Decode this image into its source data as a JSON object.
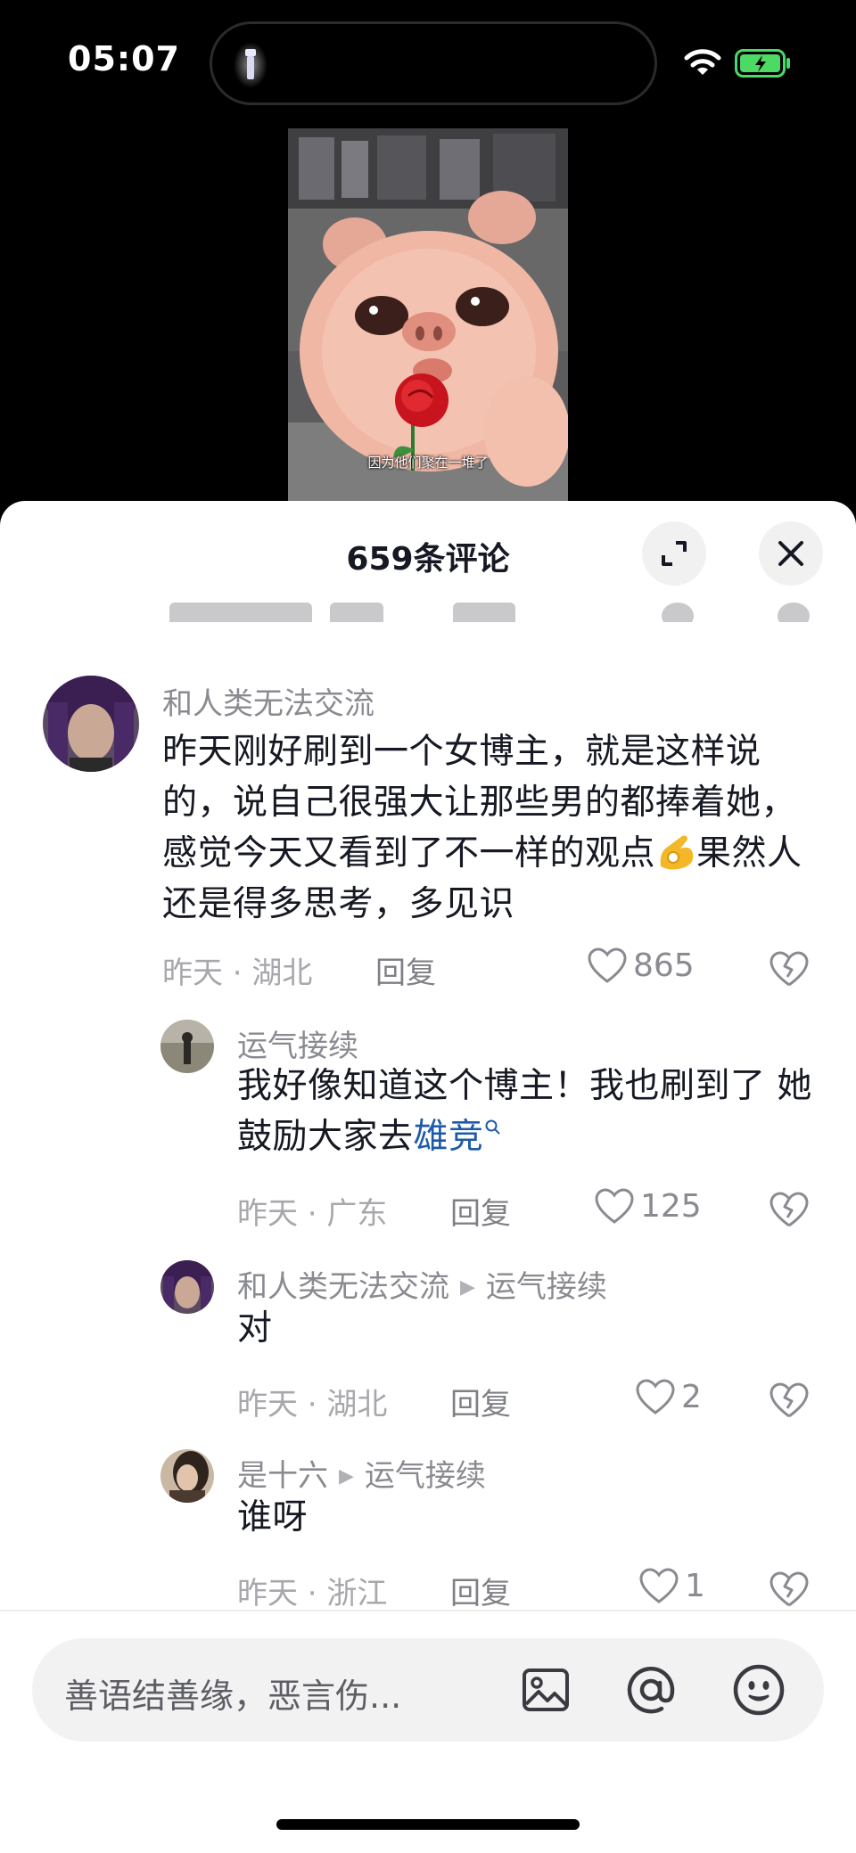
{
  "status_bar": {
    "time": "05:07"
  },
  "video": {
    "subtitle": "因为他们聚在一堆了"
  },
  "sheet": {
    "title": "659条评论",
    "close_symbol": "✕"
  },
  "comments": [
    {
      "username": "和人类无法交流",
      "text_1": "昨天刚好刷到一个女博主，就是这样说的，说自己很强大让那些男的都捧着她，感觉今天又看到了不一样的观点",
      "text_2": "果然人还是得多思考，多见识",
      "emoji": "ok-hand-emoji",
      "meta": "昨天 · 湖北",
      "reply": "回复",
      "likes": "865"
    },
    {
      "username": "运气接续",
      "text_1": "我好像知道这个博主！我也刷到了 她鼓励大家去",
      "link": "雄竞",
      "meta": "昨天 · 广东",
      "reply": "回复",
      "likes": "125"
    },
    {
      "username": "和人类无法交流",
      "reply_to": "运气接续",
      "text_1": "对",
      "meta": "昨天 · 湖北",
      "reply": "回复",
      "likes": "2"
    },
    {
      "username": "是十六",
      "reply_to": "运气接续",
      "text_1": "谁呀",
      "meta": "昨天 · 浙江",
      "reply": "回复",
      "likes": "1"
    }
  ],
  "input": {
    "placeholder": "善语结善缘，恶言伤...",
    "at_symbol": "@"
  },
  "colors": {
    "text": "#161823",
    "muted": "#8a8b91",
    "link": "#1d5aa8",
    "battery": "#4cd964"
  }
}
